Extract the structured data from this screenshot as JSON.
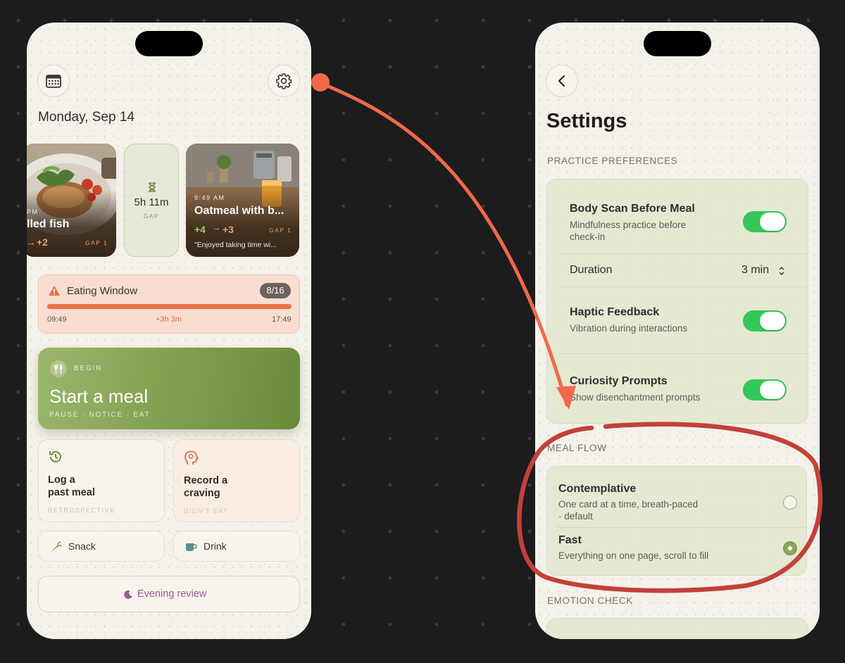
{
  "left_phone": {
    "date": "Monday, Sep 14",
    "header": {
      "calendar_icon": "calendar-icon",
      "settings_icon": "gear-icon"
    },
    "meals": [
      {
        "time": "PM",
        "title": "lled fish",
        "score_from": "→",
        "score_to": "+2",
        "gap": "GAP 1"
      },
      {
        "time": "9:49 AM",
        "title": "Oatmeal with b...",
        "score_from": "+4",
        "arrow": "→",
        "score_to": "+3",
        "gap": "GAP 1",
        "quote": "\"Enjoyed taking time wi..."
      }
    ],
    "gap_card": {
      "icon": "hourglass-icon",
      "value": "5h 11m",
      "label": "GAP"
    },
    "eating_window": {
      "icon": "warning-icon",
      "title": "Eating Window",
      "badge": "8/16",
      "progress": 1.0,
      "start": "09:49",
      "over": "+3h 3m",
      "end": "17:49",
      "accent": "#e8704a"
    },
    "start_meal": {
      "icon": "utensils-icon",
      "eyebrow": "BEGIN",
      "title": "Start a meal",
      "subtitle": "PAUSE · NOTICE · EAT"
    },
    "tiles": {
      "log": {
        "icon": "history-icon",
        "label_line1": "Log a",
        "label_line2": "past meal",
        "sub": "RETROSPECTIVE"
      },
      "craving": {
        "icon": "head-icon",
        "label_line1": "Record a",
        "label_line2": "craving",
        "sub": "DIDN'T EAT"
      },
      "snack": {
        "icon": "carrot-icon",
        "label": "Snack"
      },
      "drink": {
        "icon": "cup-icon",
        "label": "Drink"
      }
    },
    "evening_review": {
      "icon": "moon-icon",
      "label": "Evening review",
      "color": "#9a5a9a"
    }
  },
  "right_phone": {
    "back_icon": "chevron-left-icon",
    "title": "Settings",
    "practice_header": "PRACTICE PREFERENCES",
    "practice": {
      "body_scan": {
        "title": "Body Scan Before Meal",
        "sub_line1": "Mindfulness practice before",
        "sub_line2": "check-in",
        "enabled": true
      },
      "duration": {
        "label": "Duration",
        "value": "3 min"
      },
      "haptic": {
        "title": "Haptic Feedback",
        "sub": "Vibration during interactions",
        "enabled": true
      },
      "curiosity": {
        "title": "Curiosity Prompts",
        "sub": "Show disenchantment prompts",
        "enabled": true
      }
    },
    "meal_flow_header": "MEAL FLOW",
    "meal_flow": {
      "contemplative": {
        "title": "Contemplative",
        "sub_line1": "One card at a time, breath-paced",
        "sub_line2": "· default",
        "selected": false
      },
      "fast": {
        "title": "Fast",
        "sub": "Everything on one page, scroll to fill",
        "selected": true
      }
    },
    "emotion_header": "EMOTION CHECK"
  },
  "colors": {
    "toggle_on": "#34c759",
    "annotation_arrow": "#f0694a",
    "annotation_circle": "#c2413a",
    "green_accent": "#7f9c4d"
  }
}
